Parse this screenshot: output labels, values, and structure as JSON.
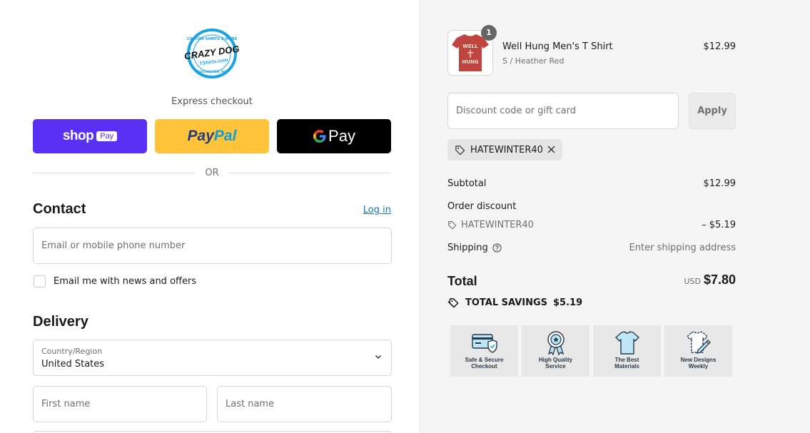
{
  "brand": {
    "logo_top": "CUSTOM SHIRTS & MORE",
    "logo_main": "CRAZY DOG",
    "logo_sub": "TShirts.com",
    "logo_bottom": "ROCHESTER, NY",
    "colors": {
      "shop_pay": "#5a31f4",
      "paypal": "#ffc439",
      "gpay": "#000000",
      "link": "#1773b0",
      "logo_blue": "#1aa3e0"
    }
  },
  "express": {
    "title": "Express checkout",
    "shop_label": "shop",
    "shop_tag": "Pay",
    "paypal_a": "Pay",
    "paypal_b": "Pal",
    "gpay_g": "G",
    "gpay_label": "Pay",
    "or": "OR"
  },
  "contact": {
    "heading": "Contact",
    "login": "Log in",
    "email_placeholder": "Email or mobile phone number",
    "newsletter_label": "Email me with news and offers"
  },
  "delivery": {
    "heading": "Delivery",
    "country_label": "Country/Region",
    "country_value": "United States",
    "first_name_placeholder": "First name",
    "last_name_placeholder": "Last name"
  },
  "order": {
    "item": {
      "name": "Well Hung Men's T Shirt",
      "variant": "S / Heather Red",
      "price": "$12.99",
      "quantity": "1",
      "shirt_text_top": "WELL",
      "shirt_text_bottom": "HUNG"
    },
    "discount_placeholder": "Discount code or gift card",
    "apply_label": "Apply",
    "applied_code": "HATEWINTER40",
    "subtotal_label": "Subtotal",
    "subtotal_value": "$12.99",
    "order_discount_label": "Order discount",
    "discount_code": "HATEWINTER40",
    "discount_value": "– $5.19",
    "shipping_label": "Shipping",
    "shipping_value": "Enter shipping address",
    "total_label": "Total",
    "currency": "USD",
    "total_value": "$7.80",
    "savings_label": "TOTAL SAVINGS",
    "savings_value": "$5.19"
  },
  "badges": [
    {
      "line1": "Safe & Secure",
      "line2": "Checkout",
      "icon": "credit-card-shield-icon"
    },
    {
      "line1": "High Quality",
      "line2": "Service",
      "icon": "award-ribbon-icon"
    },
    {
      "line1": "The Best",
      "line2": "Materials",
      "icon": "tshirt-icon"
    },
    {
      "line1": "New Designs",
      "line2": "Weekly",
      "icon": "tshirt-pencil-icon"
    }
  ]
}
